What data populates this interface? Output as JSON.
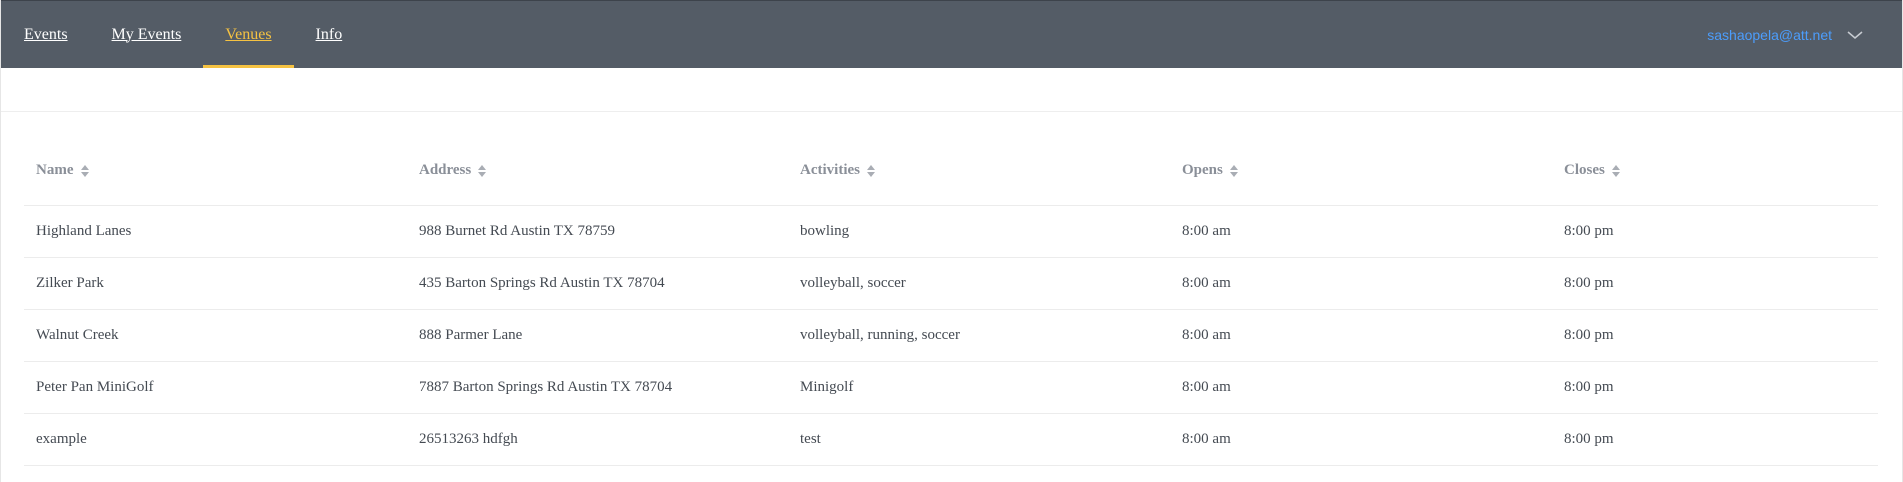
{
  "nav": {
    "items": [
      {
        "label": "Events"
      },
      {
        "label": "My Events"
      },
      {
        "label": "Venues"
      },
      {
        "label": "Info"
      }
    ],
    "active": "Venues",
    "user_email": "sashaopela@att.net"
  },
  "table": {
    "columns": [
      {
        "label": "Name"
      },
      {
        "label": "Address"
      },
      {
        "label": "Activities"
      },
      {
        "label": "Opens"
      },
      {
        "label": "Closes"
      }
    ],
    "rows": [
      {
        "name": "Highland Lanes",
        "address": "988 Burnet Rd Austin TX 78759",
        "activities": "bowling",
        "opens": "8:00 am",
        "closes": "8:00 pm"
      },
      {
        "name": "Zilker Park",
        "address": "435 Barton Springs Rd Austin TX 78704",
        "activities": "volleyball, soccer",
        "opens": "8:00 am",
        "closes": "8:00 pm"
      },
      {
        "name": "Walnut Creek",
        "address": "888 Parmer Lane",
        "activities": "volleyball, running, soccer",
        "opens": "8:00 am",
        "closes": "8:00 pm"
      },
      {
        "name": "Peter Pan MiniGolf",
        "address": "7887 Barton Springs Rd Austin TX 78704",
        "activities": "Minigolf",
        "opens": "8:00 am",
        "closes": "8:00 pm"
      },
      {
        "name": "example",
        "address": "26513263 hdfgh",
        "activities": "test",
        "opens": "8:00 am",
        "closes": "8:00 pm"
      }
    ]
  },
  "icons": {
    "sort": "sort-icon",
    "dropdown": "chevron-down-icon"
  },
  "colors": {
    "navbar_bg": "#545c66",
    "active_accent": "#f5c242",
    "email_link": "#4c9dfc",
    "header_text": "#8a8f98",
    "body_text": "#444a52"
  }
}
